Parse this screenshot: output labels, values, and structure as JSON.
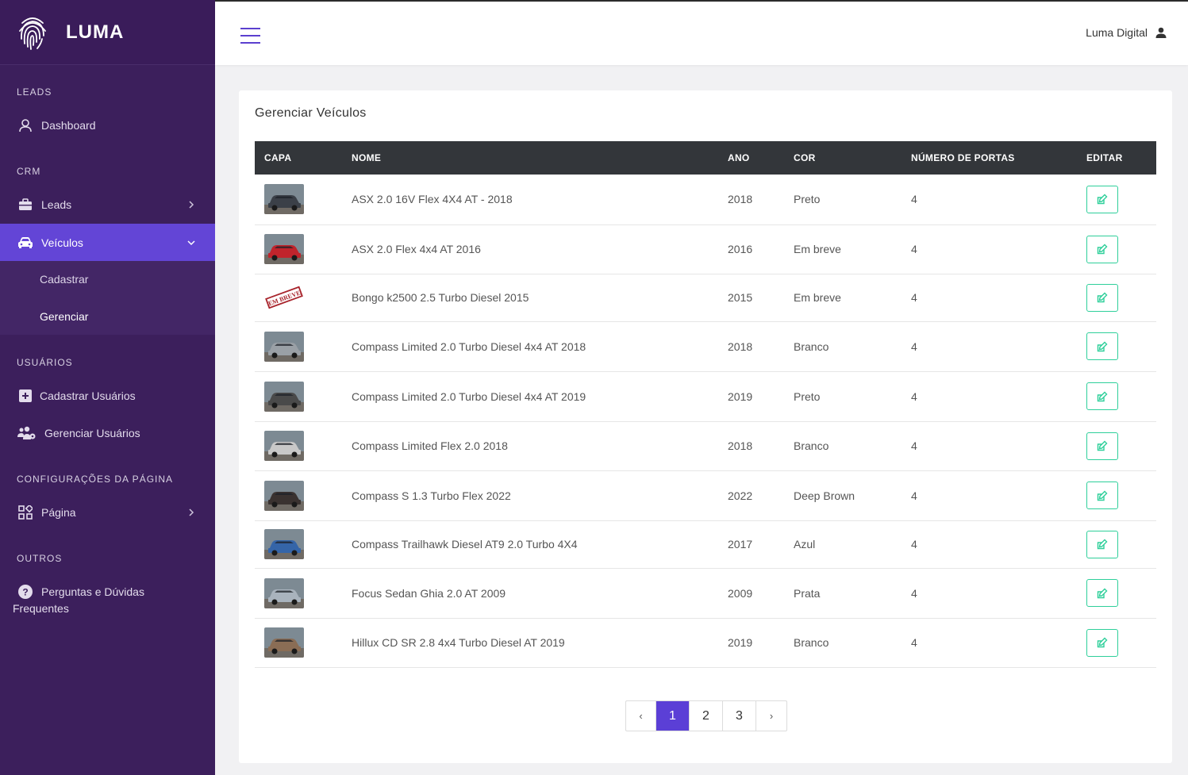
{
  "brand": {
    "name": "LUMA"
  },
  "sidebar": {
    "sections": {
      "leads": "LEADS",
      "crm": "CRM",
      "usuarios": "USUÁRIOS",
      "config": "CONFIGURAÇÕES DA PÁGINA",
      "outros": "OUTROS"
    },
    "items": {
      "dashboard": "Dashboard",
      "leads": "Leads",
      "veiculos": "Veículos",
      "cadastrar": "Cadastrar",
      "gerenciar": "Gerenciar",
      "cadastrar_usuarios": "Cadastrar Usuários",
      "gerenciar_usuarios": "Gerenciar Usuários",
      "pagina": "Página",
      "faq_line1": "Perguntas e Dúvidas",
      "faq_line2": "Frequentes"
    }
  },
  "topbar": {
    "user_name": "Luma Digital"
  },
  "main": {
    "title": "Gerenciar Veículos",
    "columns": [
      "CAPA",
      "NOME",
      "ANO",
      "COR",
      "NÚMERO DE PORTAS",
      "EDITAR"
    ],
    "rows": [
      {
        "nome": "ASX 2.0 16V Flex 4X4 AT - 2018",
        "ano": "2018",
        "cor": "Preto",
        "portas": "4",
        "thumb": "#3b4048"
      },
      {
        "nome": "ASX 2.0 Flex 4x4 AT 2016",
        "ano": "2016",
        "cor": "Em breve",
        "portas": "4",
        "thumb": "#c0242c"
      },
      {
        "nome": "Bongo k2500 2.5 Turbo Diesel 2015",
        "ano": "2015",
        "cor": "Em breve",
        "portas": "4",
        "thumb": "stamp"
      },
      {
        "nome": "Compass Limited 2.0 Turbo Diesel 4x4 AT 2018",
        "ano": "2018",
        "cor": "Branco",
        "portas": "4",
        "thumb": "#9aa0a6"
      },
      {
        "nome": "Compass Limited 2.0 Turbo Diesel 4x4 AT 2019",
        "ano": "2019",
        "cor": "Preto",
        "portas": "4",
        "thumb": "#4a4a4a"
      },
      {
        "nome": "Compass Limited Flex 2.0 2018",
        "ano": "2018",
        "cor": "Branco",
        "portas": "4",
        "thumb": "#c8c8c8"
      },
      {
        "nome": "Compass S 1.3 Turbo Flex 2022",
        "ano": "2022",
        "cor": "Deep Brown",
        "portas": "4",
        "thumb": "#3a3230"
      },
      {
        "nome": "Compass Trailhawk Diesel AT9 2.0 Turbo 4X4",
        "ano": "2017",
        "cor": "Azul",
        "portas": "4",
        "thumb": "#3565a8"
      },
      {
        "nome": "Focus Sedan Ghia 2.0 AT 2009",
        "ano": "2009",
        "cor": "Prata",
        "portas": "4",
        "thumb": "#a9b3bd"
      },
      {
        "nome": "Hillux CD SR 2.8 4x4 Turbo Diesel AT 2019",
        "ano": "2019",
        "cor": "Branco",
        "portas": "4",
        "thumb": "#8a6d55"
      }
    ],
    "stamp_text": "EM BREVE"
  },
  "pagination": {
    "prev": "‹",
    "next": "›",
    "pages": [
      "1",
      "2",
      "3"
    ],
    "current": "1"
  },
  "colors": {
    "sidebar": "#3c1f5c",
    "accent": "#5b3fd6",
    "edit": "#2ecf9a",
    "table_header": "#33363a"
  }
}
